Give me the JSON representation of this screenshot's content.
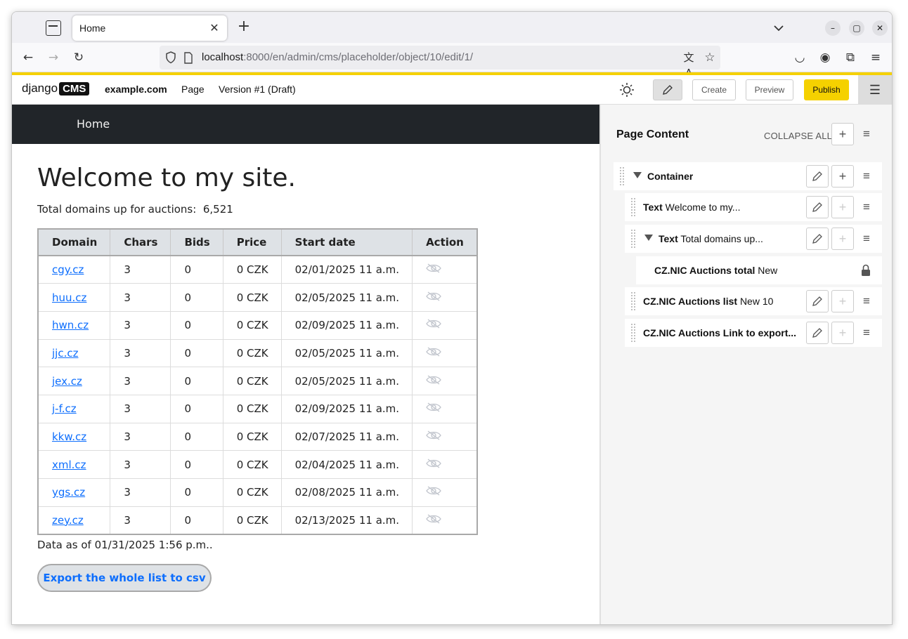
{
  "browser": {
    "tab_title": "Home",
    "url_host": "localhost",
    "url_rest": ":8000/en/admin/cms/placeholder/object/10/edit/1/"
  },
  "cms_toolbar": {
    "logo_text": "django",
    "logo_badge": "CMS",
    "site": "example.com",
    "page_menu": "Page",
    "version": "Version #1 (Draft)",
    "create_label": "Create",
    "preview_label": "Preview",
    "publish_label": "Publish"
  },
  "site": {
    "nav_home": "Home",
    "heading": "Welcome to my site.",
    "total_label": "Total domains up for auctions:",
    "total_value": "6,521",
    "table": {
      "headers": [
        "Domain",
        "Chars",
        "Bids",
        "Price",
        "Start date",
        "Action"
      ],
      "rows": [
        [
          "cgy.cz",
          "3",
          "0",
          "0 CZK",
          "02/01/2025 11 a.m."
        ],
        [
          "huu.cz",
          "3",
          "0",
          "0 CZK",
          "02/05/2025 11 a.m."
        ],
        [
          "hwn.cz",
          "3",
          "0",
          "0 CZK",
          "02/09/2025 11 a.m."
        ],
        [
          "jjc.cz",
          "3",
          "0",
          "0 CZK",
          "02/05/2025 11 a.m."
        ],
        [
          "jex.cz",
          "3",
          "0",
          "0 CZK",
          "02/05/2025 11 a.m."
        ],
        [
          "j-f.cz",
          "3",
          "0",
          "0 CZK",
          "02/09/2025 11 a.m."
        ],
        [
          "kkw.cz",
          "3",
          "0",
          "0 CZK",
          "02/07/2025 11 a.m."
        ],
        [
          "xml.cz",
          "3",
          "0",
          "0 CZK",
          "02/04/2025 11 a.m."
        ],
        [
          "ygs.cz",
          "3",
          "0",
          "0 CZK",
          "02/08/2025 11 a.m."
        ],
        [
          "zey.cz",
          "3",
          "0",
          "0 CZK",
          "02/13/2025 11 a.m."
        ]
      ]
    },
    "data_as_of": "Data as of 01/31/2025 1:56 p.m..",
    "export_label": "Export the whole list to csv"
  },
  "structure": {
    "title": "Page Content",
    "collapse_all": "COLLAPSE ALL",
    "plugins": [
      {
        "type": "Container",
        "desc": ""
      },
      {
        "type": "Text",
        "desc": "Welcome to my..."
      },
      {
        "type": "Text",
        "desc": "Total domains up..."
      },
      {
        "type": "CZ.NIC Auctions total",
        "desc": "New"
      },
      {
        "type": "CZ.NIC Auctions list",
        "desc": "New 10"
      },
      {
        "type": "CZ.NIC Auctions Link to export...",
        "desc": ""
      }
    ]
  },
  "colors": {
    "cms_yellow": "#f5d100",
    "site_nav_bg": "#212529",
    "link_blue": "#0d6efd"
  }
}
